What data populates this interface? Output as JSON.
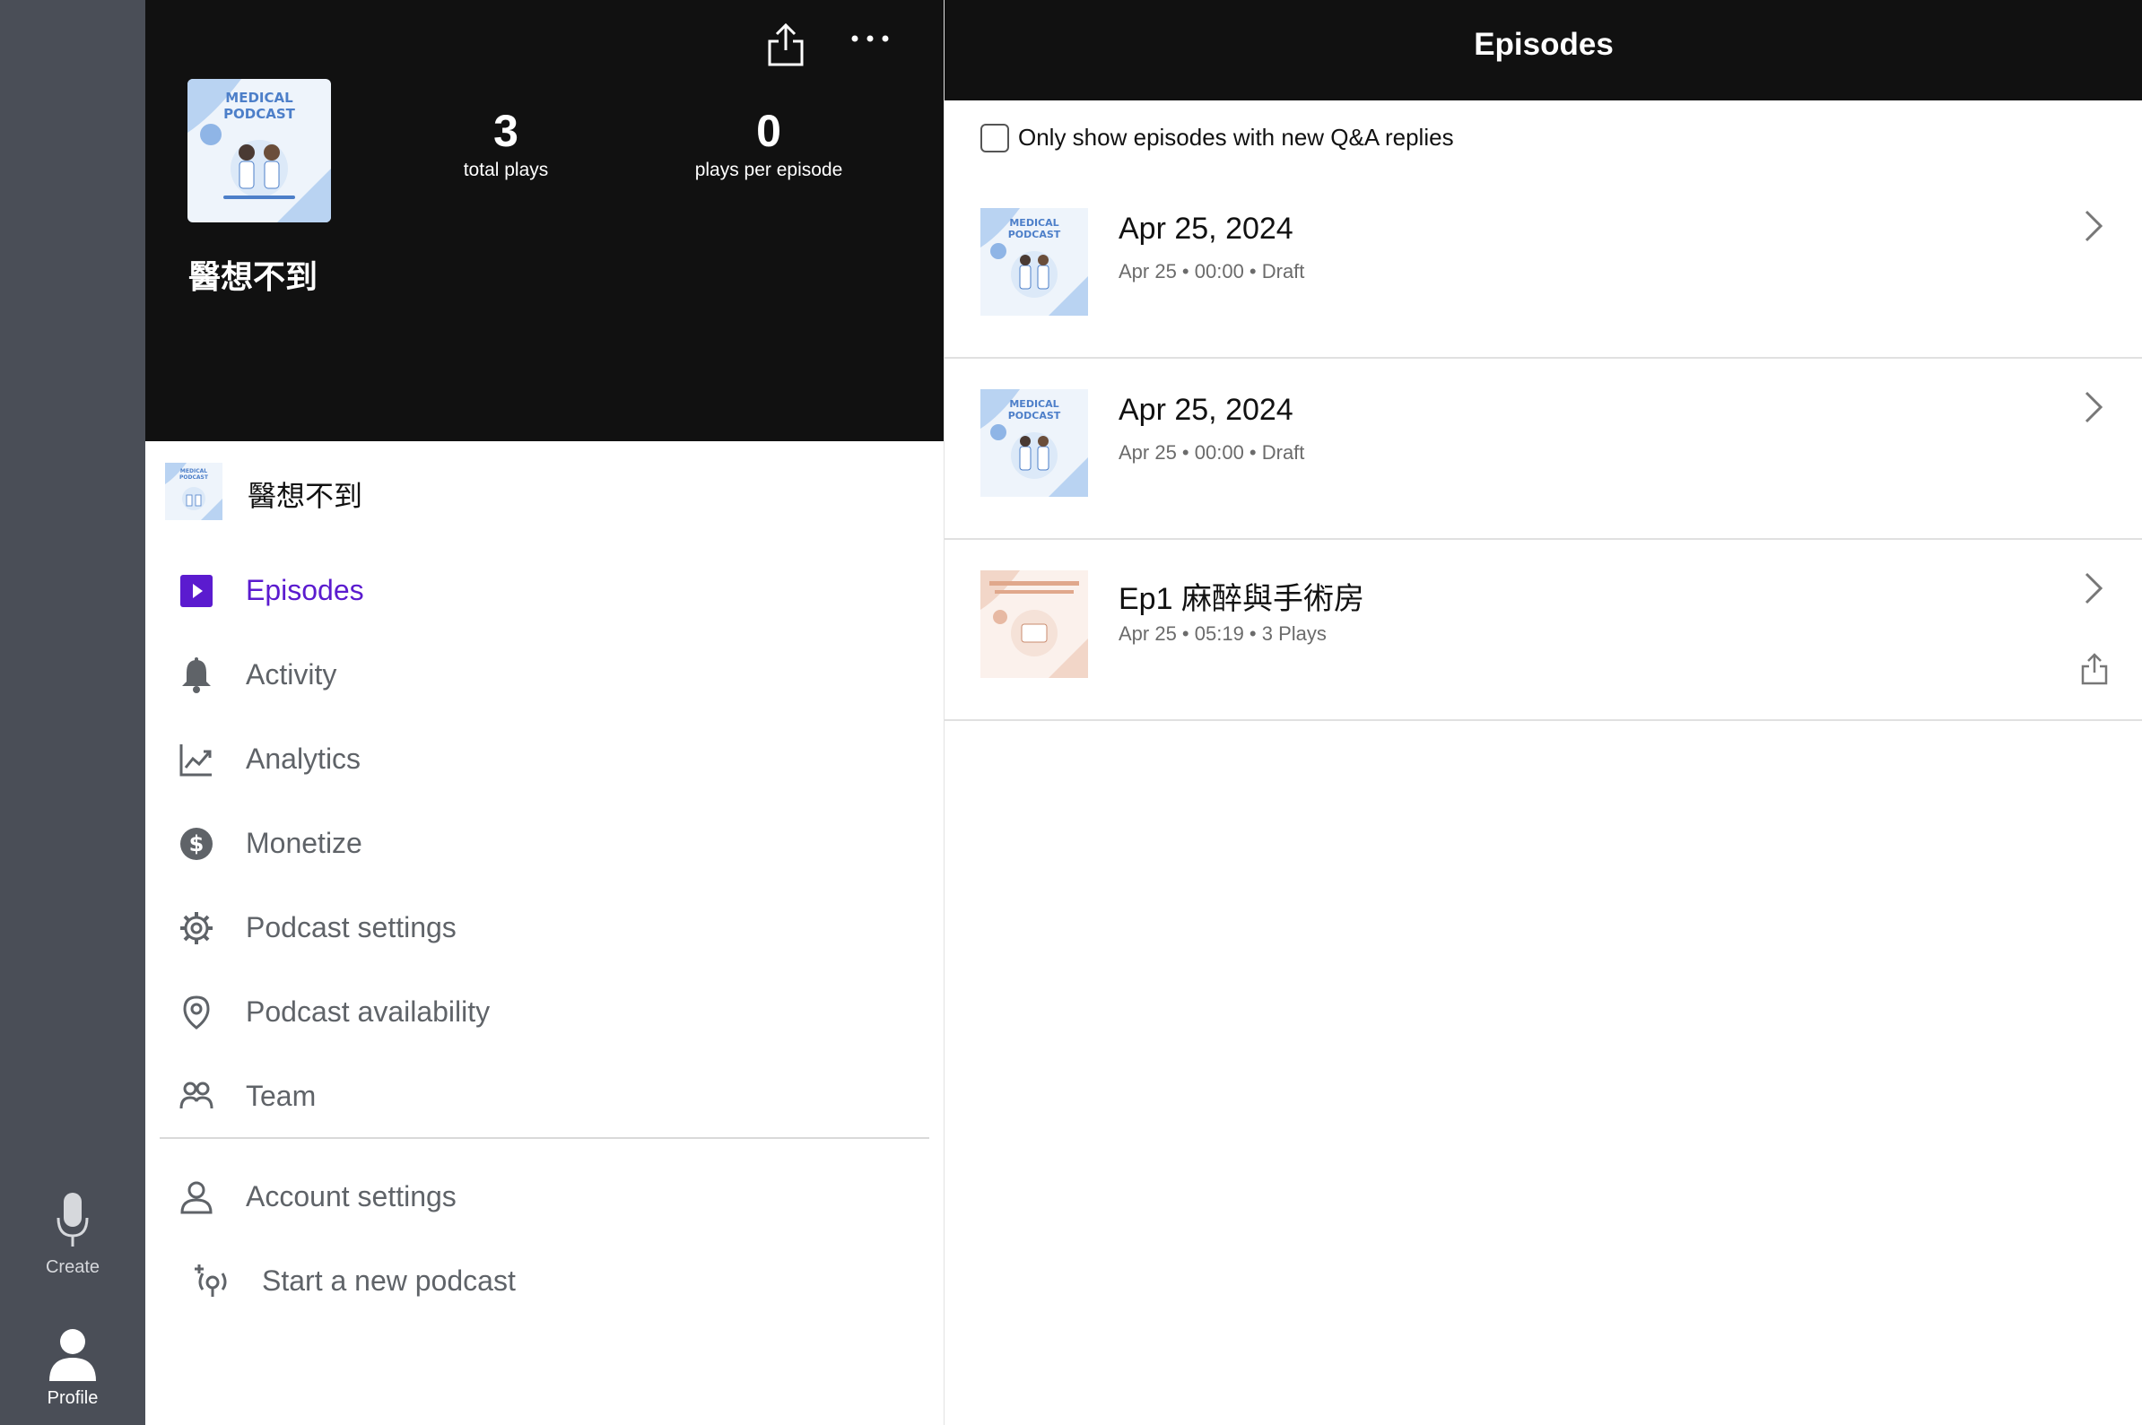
{
  "rail": {
    "create_label": "Create",
    "profile_label": "Profile"
  },
  "hero": {
    "podcast_name": "醫想不到",
    "stats": [
      {
        "value": "3",
        "caption": "total plays"
      },
      {
        "value": "0",
        "caption": "plays per episode"
      }
    ]
  },
  "sidebar": {
    "podcast_name": "醫想不到",
    "items": [
      {
        "label": "Episodes",
        "icon": "play-square-icon",
        "active": true
      },
      {
        "label": "Activity",
        "icon": "bell-icon"
      },
      {
        "label": "Analytics",
        "icon": "chart-icon"
      },
      {
        "label": "Monetize",
        "icon": "dollar-icon"
      },
      {
        "label": "Podcast settings",
        "icon": "gear-icon"
      },
      {
        "label": "Podcast availability",
        "icon": "location-pin-icon"
      },
      {
        "label": "Team",
        "icon": "team-icon"
      }
    ],
    "secondary": [
      {
        "label": "Account settings",
        "icon": "person-icon"
      },
      {
        "label": "Start a new podcast",
        "icon": "new-podcast-icon"
      }
    ]
  },
  "main": {
    "title": "Episodes",
    "filter_label": "Only show episodes with new Q&A replies",
    "episodes": [
      {
        "title": "Apr 25, 2024",
        "meta": "Apr 25 • 00:00 • Draft",
        "art": "medical"
      },
      {
        "title": "Apr 25, 2024",
        "meta": "Apr 25 • 00:00 • Draft",
        "art": "medical"
      },
      {
        "title": "Ep1 麻醉與手術房",
        "meta": "Apr 25 • 05:19 • 3 Plays",
        "art": "anesthesia"
      }
    ]
  },
  "colors": {
    "accent": "#5b1bcf",
    "hero_bg": "#111111",
    "rail_bg": "#4a4e57"
  }
}
